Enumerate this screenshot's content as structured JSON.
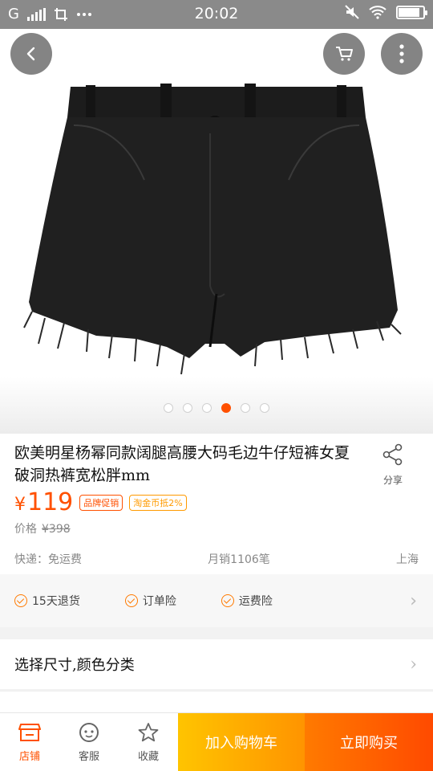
{
  "status_bar": {
    "carrier": "G",
    "time": "20:02",
    "icons": [
      "signal-icon",
      "screenshot-icon",
      "more-dots-icon",
      "mute-icon",
      "wifi-icon",
      "battery-icon"
    ]
  },
  "gallery": {
    "image": "black-denim-shorts-icon",
    "dot_count": 6,
    "active_index": 3,
    "back_icon": "back-arrow-icon",
    "cart_icon": "cart-icon",
    "more_icon": "more-vertical-icon"
  },
  "product": {
    "title": "欧美明星杨幂同款阔腿高腰大码毛边牛仔短裤女夏破洞热裤宽松胖mm",
    "share_label": "分享",
    "currency": "¥",
    "price": "119",
    "tags": [
      "品牌促销",
      "淘金币抵2%"
    ],
    "original_label": "价格",
    "original_price": "¥398",
    "shipping": "快递：免运费",
    "monthly_sales": "月销1106笔",
    "location": "上海"
  },
  "services": [
    "15天退货",
    "订单险",
    "运费险"
  ],
  "spec": {
    "label": "选择尺寸,颜色分类"
  },
  "bottom_bar": {
    "store_label": "店铺",
    "service_label": "客服",
    "favorite_label": "收藏",
    "add_to_cart_label": "加入购物车",
    "buy_now_label": "立即购买"
  },
  "colors": {
    "accent": "#ff5000",
    "cart_button": "#ffa800",
    "buy_button": "#ff5a00"
  }
}
